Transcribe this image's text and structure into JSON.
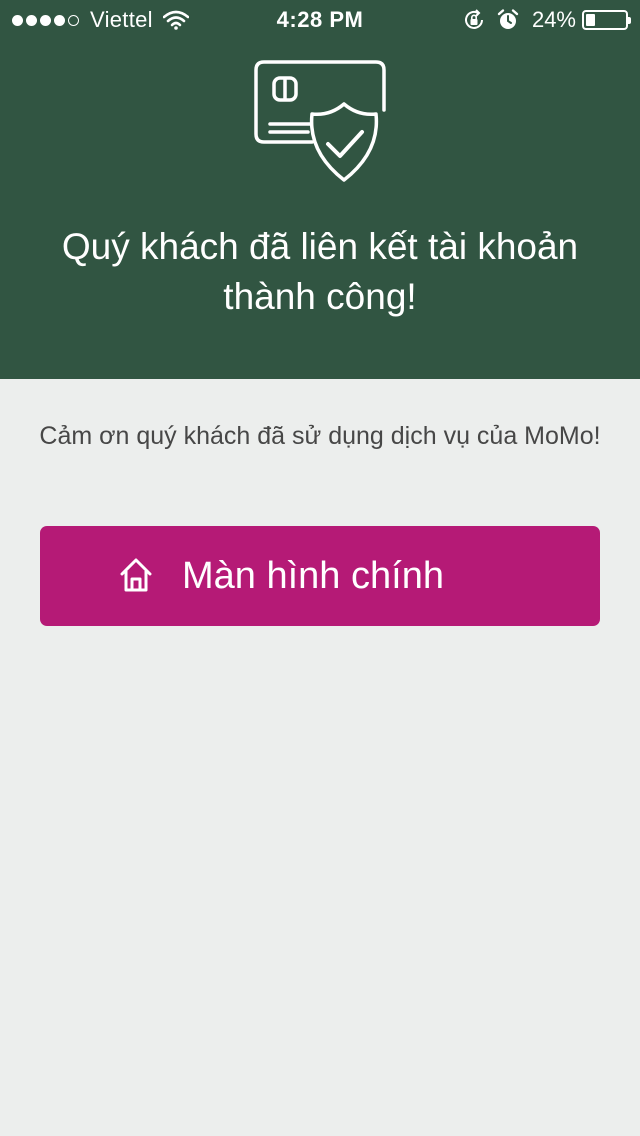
{
  "status_bar": {
    "carrier": "Viettel",
    "time": "4:28 PM",
    "battery_percent_label": "24%",
    "battery_level": 0.24,
    "signal_bars_filled": 4,
    "signal_bars_total": 5,
    "icons": [
      "wifi-icon",
      "rotation-lock-icon",
      "alarm-icon",
      "battery-icon"
    ]
  },
  "header": {
    "icon": "card-shield-check-icon",
    "title": "Quý khách đã liên kết tài khoản thành công!"
  },
  "main": {
    "message": "Cảm ơn quý khách đã sử dụng dịch vụ của MoMo!",
    "home_button": {
      "label": "Màn hình chính",
      "icon": "home-icon"
    }
  },
  "colors": {
    "header_background": "#315542",
    "page_background": "#eceeed",
    "button_background": "#b51a76",
    "message_text": "#474747",
    "on_dark_text": "#ffffff"
  }
}
